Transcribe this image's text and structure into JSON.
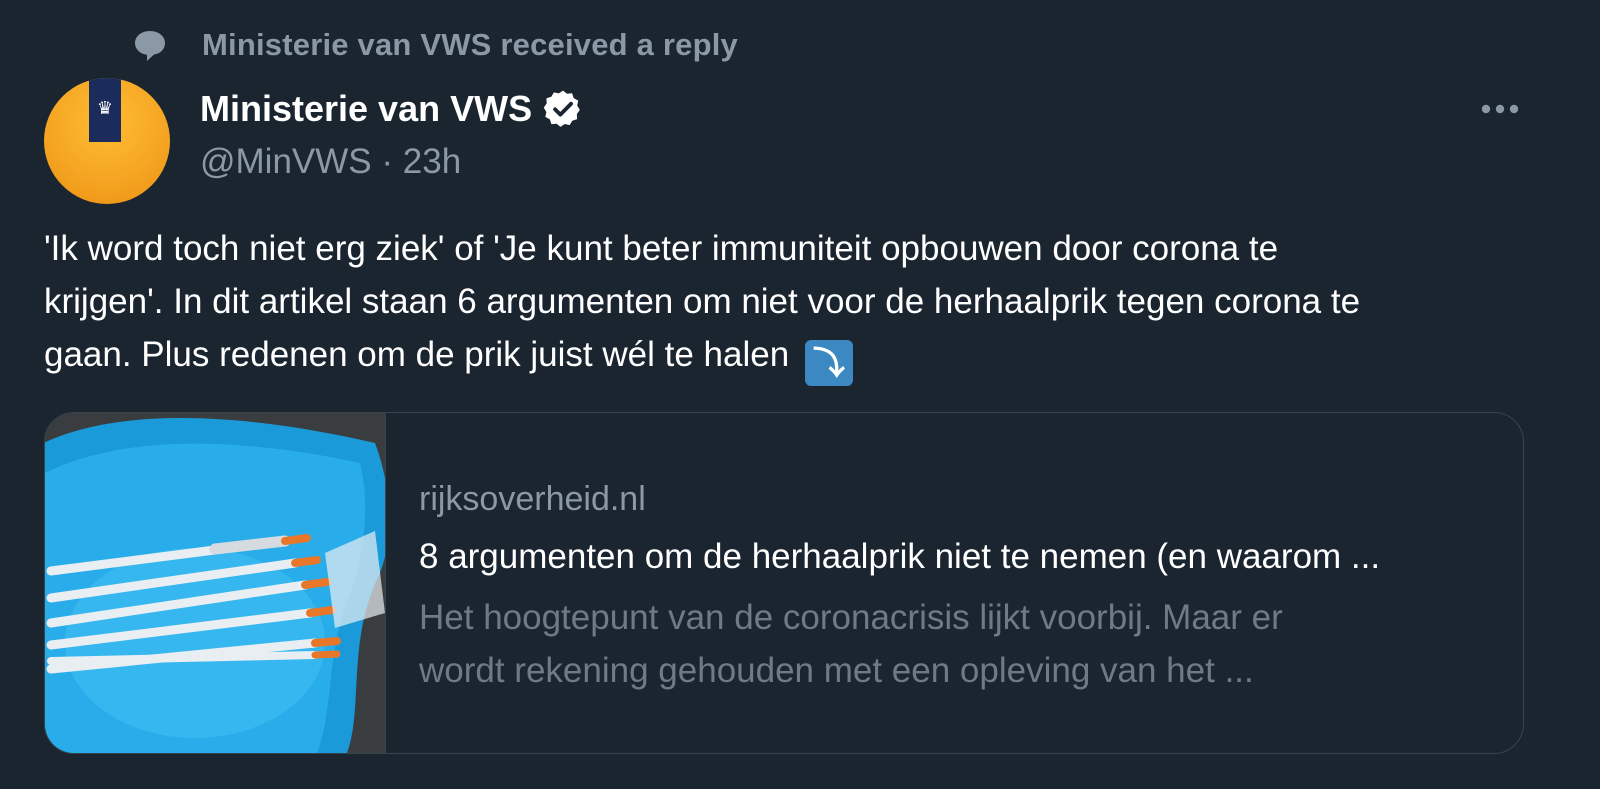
{
  "context": {
    "text": "Ministerie van VWS received a reply",
    "icon": "speech-bubble-icon"
  },
  "author": {
    "name": "Ministerie van VWS",
    "verified_icon": "verified-badge-icon",
    "handle": "@MinVWS",
    "separator": "·",
    "time": "23h",
    "avatar_colors": {
      "background": "#f5a623",
      "band": "#1b2b5b"
    }
  },
  "more_icon": "more-options-icon",
  "tweet": {
    "line1": "'Ik word toch niet erg ziek' of 'Je kunt beter immuniteit opbouwen door corona te",
    "line2": "krijgen'. In dit artikel staan 6 argumenten om niet voor de herhaalprik tegen corona te",
    "line3": "gaan. Plus redenen om de prik juist wél te halen",
    "emoji": "⤵",
    "emoji_icon": "arrow-curving-down-icon"
  },
  "card": {
    "domain": "rijksoverheid.nl",
    "title": "8 argumenten om de herhaalprik niet te nemen (en waarom ...",
    "desc_line1": "Het hoogtepunt van de coronacrisis lijkt voorbij. Maar er",
    "desc_line2": "wordt rekening gehouden met een opleving van het ..."
  },
  "colors": {
    "background": "#1b2530",
    "text_primary": "#ffffff",
    "text_secondary": "#8b98a5",
    "card_border": "#38444d",
    "emoji_blue": "#3b88c3"
  }
}
